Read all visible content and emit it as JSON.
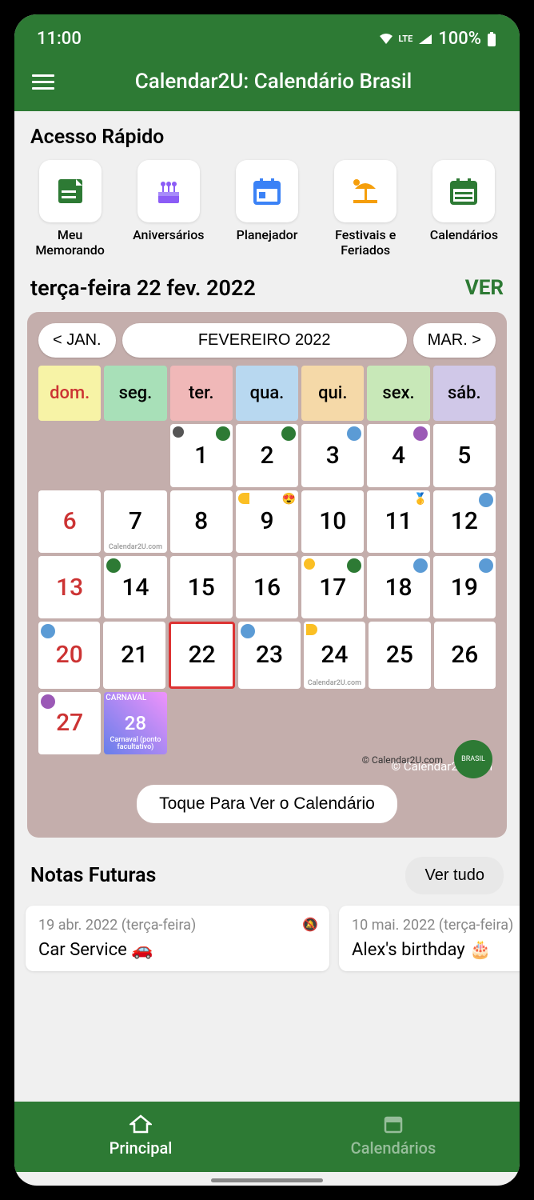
{
  "status": {
    "time": "11:00",
    "lte": "LTE",
    "battery": "100%"
  },
  "app": {
    "title": "Calendar2U: Calendário Brasil"
  },
  "quick_access": {
    "title": "Acesso Rápido",
    "items": [
      {
        "label": "Meu Memorando",
        "icon": "memo-icon",
        "color": "#2d7a34"
      },
      {
        "label": "Aniversários",
        "icon": "cake-icon",
        "color": "#8b5cf6"
      },
      {
        "label": "Planejador",
        "icon": "planner-icon",
        "color": "#3b82f6"
      },
      {
        "label": "Festivais e Feriados",
        "icon": "beach-icon",
        "color": "#f59e0b"
      },
      {
        "label": "Calendários",
        "icon": "calendar-icon",
        "color": "#2d7a34"
      }
    ]
  },
  "current_date": {
    "text": "terça-feira 22 fev. 2022",
    "ver": "VER"
  },
  "calendar": {
    "prev": "< JAN.",
    "current": "FEVEREIRO 2022",
    "next": "MAR. >",
    "weekdays": [
      "dom.",
      "seg.",
      "ter.",
      "qua.",
      "qui.",
      "sex.",
      "sáb."
    ],
    "watermark": "Calendar2U.com",
    "copyright": "© Calendar2U.com",
    "copyright_lg": "© Calendar2U.com",
    "flag": "BRASIL",
    "tap": "Toque Para Ver o Calendário",
    "carnival": "Carnaval (ponto facultativo)",
    "days": [
      [
        null,
        null,
        "1",
        "2",
        "3",
        "4",
        "5"
      ],
      [
        "6",
        "7",
        "8",
        "9",
        "10",
        "11",
        "12"
      ],
      [
        "13",
        "14",
        "15",
        "16",
        "17",
        "18",
        "19"
      ],
      [
        "20",
        "21",
        "22",
        "23",
        "24",
        "25",
        "26"
      ],
      [
        "27",
        "28",
        null,
        null,
        null,
        null,
        null
      ]
    ]
  },
  "notes": {
    "title": "Notas Futuras",
    "ver_tudo": "Ver tudo",
    "items": [
      {
        "date": "19 abr. 2022 (terça-feira)",
        "title": "Car Service 🚗"
      },
      {
        "date": "10 mai. 2022 (terça-feira)",
        "title": "Alex's birthday 🎂"
      }
    ]
  },
  "bottom_nav": [
    {
      "label": "Principal",
      "active": true
    },
    {
      "label": "Calendários",
      "active": false
    }
  ]
}
